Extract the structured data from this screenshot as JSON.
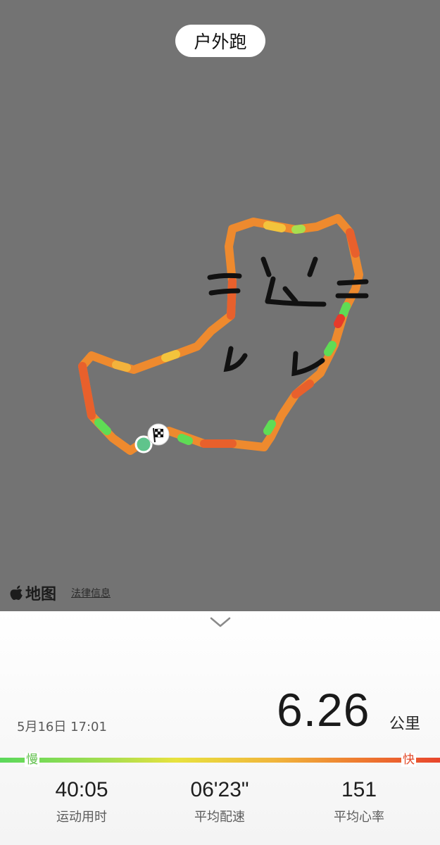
{
  "map": {
    "title": "户外跑",
    "logo_text": "地图",
    "legal_link": "法律信息",
    "start_marker_color": "#5fc48c",
    "finish_icon": "checkered-flag-icon",
    "route_colors": [
      "#f0912e",
      "#e96a2c",
      "#f2b43c",
      "#5fdc55",
      "#e8452c"
    ]
  },
  "summary": {
    "date": "5月16日 17:01",
    "distance": "6.26",
    "distance_unit": "公里",
    "slow_label": "慢",
    "fast_label": "快"
  },
  "stats": [
    {
      "value": "40:05",
      "label": "运动用时"
    },
    {
      "value": "06'23\"",
      "label": "平均配速"
    },
    {
      "value": "151",
      "label": "平均心率"
    }
  ]
}
